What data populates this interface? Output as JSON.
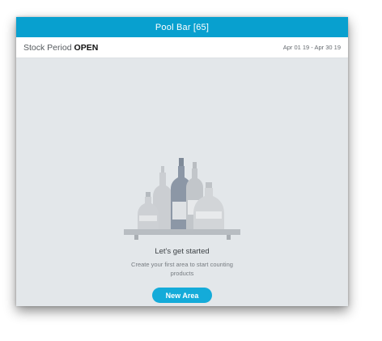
{
  "header": {
    "title": "Pool Bar [65]"
  },
  "stock_period": {
    "label": "Stock Period",
    "state": "OPEN",
    "date_range": "Apr 01 19 - Apr 30 19"
  },
  "empty_state": {
    "title": "Let's get started",
    "description": "Create your first area to start counting products",
    "button_label": "New Area",
    "illustration": "bottles-on-shelf-icon"
  },
  "colors": {
    "accent": "#08a0cf",
    "button": "#14abd9",
    "background": "#e3e7ea"
  }
}
